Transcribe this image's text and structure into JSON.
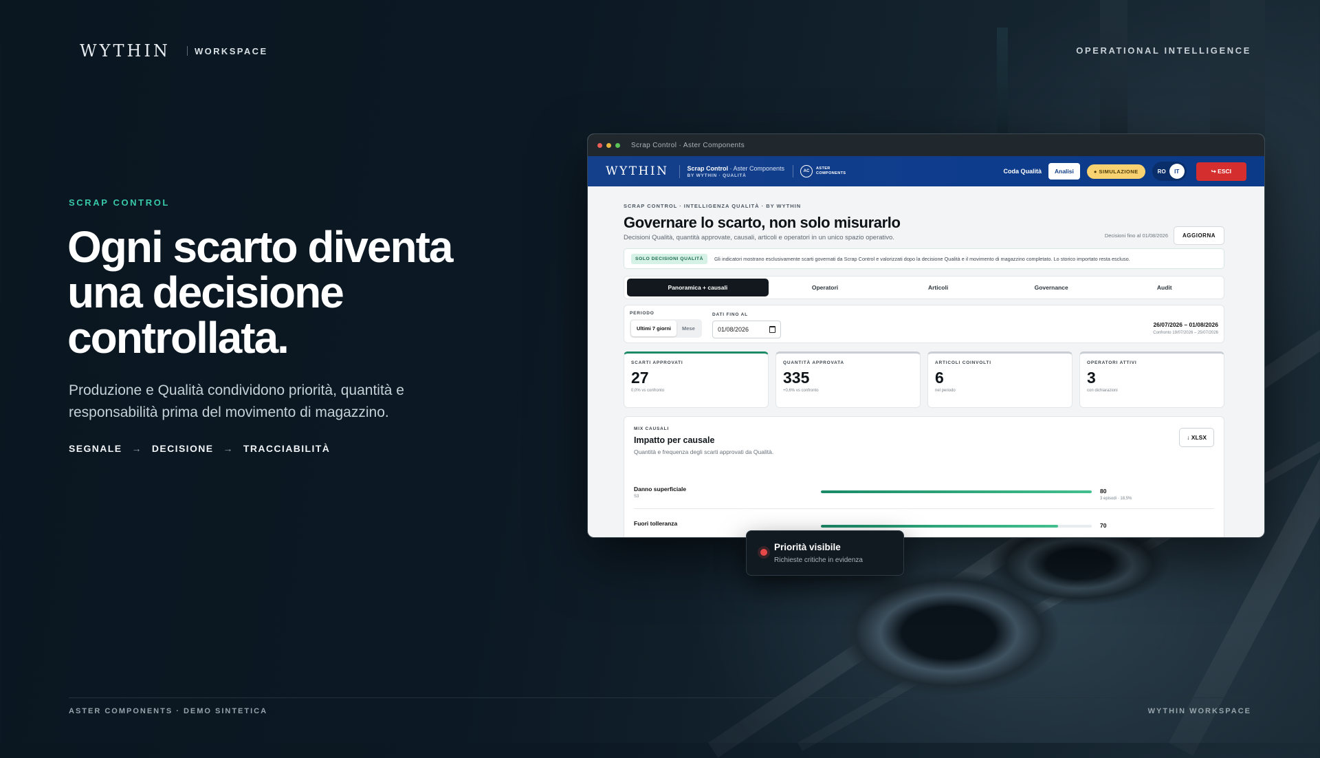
{
  "brand": {
    "logo": "WYTHIN",
    "workspace": "WORKSPACE"
  },
  "top_right": "OPERATIONAL INTELLIGENCE",
  "hero": {
    "kicker": "SCRAP CONTROL",
    "headline": "Ogni scarto diventa una decisione controllata.",
    "subtitle": "Produzione e Qualità condividono priorità, quantità e responsabilità prima del movimento di magazzino.",
    "steps": [
      "SEGNALE",
      "DECISIONE",
      "TRACCIABILITÀ"
    ],
    "arrow": "→"
  },
  "footer": {
    "left": "ASTER COMPONENTS · DEMO SINTETICA",
    "right": "WYTHIN WORKSPACE"
  },
  "window": {
    "title": "Scrap Control · Aster Components",
    "dots": [
      "#ec5f57",
      "#e8b53d",
      "#5bc357"
    ]
  },
  "app_header": {
    "logo": "WYTHIN",
    "title": "Scrap Control",
    "title_suffix": " · Aster Components",
    "subtitle": "BY WYTHIN · QUALITÀ",
    "client_badge": "AC",
    "client_name": "ASTER COMPONENTS",
    "queue_link": "Coda Qualità",
    "analysis_button": "Analisi",
    "simulation_badge": "SIMULAZIONE",
    "languages": [
      "RO",
      "IT"
    ],
    "active_language": "IT",
    "exit_button": "↪ ESCI"
  },
  "page": {
    "breadcrumb": "SCRAP CONTROL · INTELLIGENZA QUALITÀ · BY WYTHIN",
    "title": "Governare lo scarto, non solo misurarlo",
    "subtitle": "Decisioni Qualità, quantità approvate, causali, articoli e operatori in un unico spazio operativo.",
    "decisions_note": "Decisioni fino al 01/08/2026",
    "refresh_button": "AGGIORNA",
    "notice_tag": "SOLO DECISIONI QUALITÀ",
    "notice_text": "Gli indicatori mostrano esclusivamente scarti governati da Scrap Control e valorizzati dopo la decisione Qualità e il movimento di magazzino completato. Lo storico importato resta escluso."
  },
  "tabs": [
    "Panoramica + causali",
    "Operatori",
    "Articoli",
    "Governance",
    "Audit"
  ],
  "filters": {
    "period_label": "PERIODO",
    "period_options": [
      "Ultimi 7 giorni",
      "Mese"
    ],
    "date_label": "DATI FINO AL",
    "date_value": "01/08/2026",
    "range": "26/07/2026 – 01/08/2026",
    "compare": "Confronto 19/07/2026 – 25/07/2026"
  },
  "kpis": [
    {
      "label": "SCARTI APPROVATI",
      "value": "27",
      "note": "0,0% vs confronto"
    },
    {
      "label": "QUANTITÀ APPROVATA",
      "value": "335",
      "note": "+0,6% vs confronto"
    },
    {
      "label": "ARTICOLI COINVOLTI",
      "value": "6",
      "note": "nel periodo"
    },
    {
      "label": "OPERATORI ATTIVI",
      "value": "3",
      "note": "con dichiarazioni"
    }
  ],
  "mix": {
    "kicker": "MIX CAUSALI",
    "title": "Impatto per causale",
    "subtitle": "Quantità e frequenza degli scarti approvati da Qualità.",
    "export_button": "↓ XLSX",
    "rows": [
      {
        "name": "Danno superficiale",
        "count": "S3",
        "value": "80",
        "meta": "3 episodi · 18,5%",
        "fill": 1.0
      },
      {
        "name": "Fuori tolleranza",
        "count": "",
        "value": "70",
        "meta": "",
        "fill": 0.875
      }
    ]
  },
  "toast": {
    "title": "Priorità visibile",
    "subtitle": "Richieste critiche in evidenza",
    "dot_color": "#e94848"
  }
}
